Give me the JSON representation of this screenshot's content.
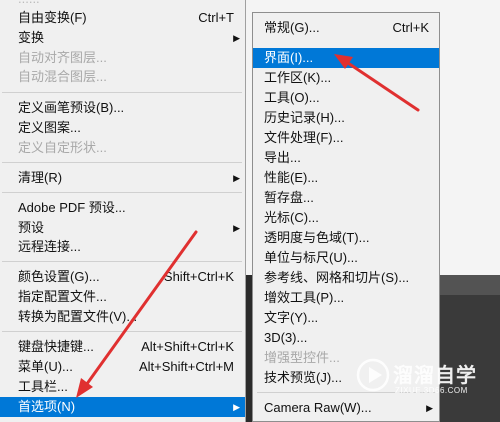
{
  "edit_menu": {
    "items": [
      {
        "label": "自由变换(F)",
        "shortcut": "Ctrl+T",
        "disabled": false
      },
      {
        "label": "变换",
        "shortcut": "",
        "disabled": false,
        "submenu": true
      },
      {
        "label": "自动对齐图层...",
        "shortcut": "",
        "disabled": true
      },
      {
        "label": "自动混合图层...",
        "shortcut": "",
        "disabled": true
      },
      {
        "label": "定义画笔预设(B)...",
        "shortcut": "",
        "disabled": false
      },
      {
        "label": "定义图案...",
        "shortcut": "",
        "disabled": false
      },
      {
        "label": "定义自定形状...",
        "shortcut": "",
        "disabled": true
      },
      {
        "label": "清理(R)",
        "shortcut": "",
        "disabled": false,
        "submenu": true
      },
      {
        "label": "Adobe PDF 预设...",
        "shortcut": "",
        "disabled": false
      },
      {
        "label": "预设",
        "shortcut": "",
        "disabled": false,
        "submenu": true
      },
      {
        "label": "远程连接...",
        "shortcut": "",
        "disabled": false
      },
      {
        "label": "颜色设置(G)...",
        "shortcut": "Shift+Ctrl+K",
        "disabled": false
      },
      {
        "label": "指定配置文件...",
        "shortcut": "",
        "disabled": false
      },
      {
        "label": "转换为配置文件(V)...",
        "shortcut": "",
        "disabled": false
      },
      {
        "label": "键盘快捷键...",
        "shortcut": "Alt+Shift+Ctrl+K",
        "disabled": false
      },
      {
        "label": "菜单(U)...",
        "shortcut": "Alt+Shift+Ctrl+M",
        "disabled": false
      },
      {
        "label": "工具栏...",
        "shortcut": "",
        "disabled": false
      },
      {
        "label": "首选项(N)",
        "shortcut": "",
        "disabled": false,
        "submenu": true,
        "selected": true
      }
    ]
  },
  "preferences_submenu": {
    "items": [
      {
        "label": "常规(G)...",
        "shortcut": "Ctrl+K",
        "disabled": false
      },
      {
        "label": "界面(I)...",
        "shortcut": "",
        "disabled": false,
        "selected": true
      },
      {
        "label": "工作区(K)...",
        "shortcut": "",
        "disabled": false
      },
      {
        "label": "工具(O)...",
        "shortcut": "",
        "disabled": false
      },
      {
        "label": "历史记录(H)...",
        "shortcut": "",
        "disabled": false
      },
      {
        "label": "文件处理(F)...",
        "shortcut": "",
        "disabled": false
      },
      {
        "label": "导出...",
        "shortcut": "",
        "disabled": false
      },
      {
        "label": "性能(E)...",
        "shortcut": "",
        "disabled": false
      },
      {
        "label": "暂存盘...",
        "shortcut": "",
        "disabled": false
      },
      {
        "label": "光标(C)...",
        "shortcut": "",
        "disabled": false
      },
      {
        "label": "透明度与色域(T)...",
        "shortcut": "",
        "disabled": false
      },
      {
        "label": "单位与标尺(U)...",
        "shortcut": "",
        "disabled": false
      },
      {
        "label": "参考线、网格和切片(S)...",
        "shortcut": "",
        "disabled": false
      },
      {
        "label": "增效工具(P)...",
        "shortcut": "",
        "disabled": false
      },
      {
        "label": "文字(Y)...",
        "shortcut": "",
        "disabled": false
      },
      {
        "label": "3D(3)...",
        "shortcut": "",
        "disabled": false
      },
      {
        "label": "增强型控件...",
        "shortcut": "",
        "disabled": true
      },
      {
        "label": "技术预览(J)...",
        "shortcut": "",
        "disabled": false
      },
      {
        "label": "Camera Raw(W)...",
        "shortcut": "",
        "disabled": false
      }
    ]
  },
  "watermark": {
    "title": "溜溜自学",
    "subtitle": "ZIXUE.3D66.COM"
  },
  "colors": {
    "selection": "#0078d7",
    "annotation_arrow": "#e03030"
  }
}
